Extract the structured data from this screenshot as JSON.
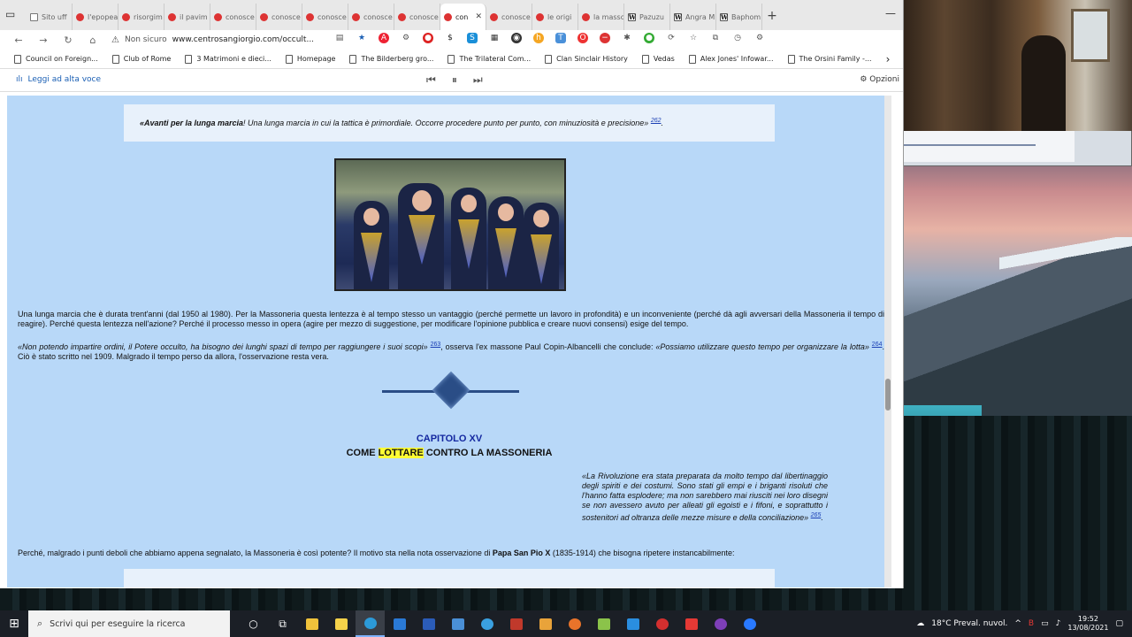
{
  "browser": {
    "tabs": [
      {
        "label": "Sito uff",
        "icon": "document-icon",
        "active": false
      },
      {
        "label": "l'epopea",
        "icon": "site-icon",
        "active": false
      },
      {
        "label": "risorgim",
        "icon": "site-icon",
        "active": false
      },
      {
        "label": "il pavim",
        "icon": "site-icon",
        "active": false
      },
      {
        "label": "conosce",
        "icon": "site-icon",
        "active": false
      },
      {
        "label": "conosce",
        "icon": "site-icon",
        "active": false
      },
      {
        "label": "conosce",
        "icon": "site-icon",
        "active": false
      },
      {
        "label": "conosce",
        "icon": "site-icon",
        "active": false
      },
      {
        "label": "conosce",
        "icon": "site-icon",
        "active": false
      },
      {
        "label": "con",
        "icon": "site-icon",
        "active": true
      },
      {
        "label": "conosce",
        "icon": "site-icon",
        "active": false
      },
      {
        "label": "le origi",
        "icon": "site-icon",
        "active": false
      },
      {
        "label": "la masso",
        "icon": "site-icon",
        "active": false
      },
      {
        "label": "Pazuzu",
        "icon": "wikipedia-icon",
        "active": false
      },
      {
        "label": "Angra M",
        "icon": "wikipedia-icon",
        "active": false
      },
      {
        "label": "Baphom",
        "icon": "wikipedia-icon",
        "active": false
      }
    ],
    "security_label": "Non sicuro",
    "url": "www.centrosangiorgio.com/occult...",
    "bookmarks": [
      "Council on Foreign...",
      "Club of Rome",
      "3 Matrimoni e dieci...",
      "Homepage",
      "The Bilderberg gro...",
      "The Trilateral Com...",
      "Clan Sinclair History",
      "Vedas",
      "Alex Jones' Infowar...",
      "The Orsini Family -..."
    ],
    "reader": {
      "read_aloud": "Leggi ad alta voce",
      "options": "Opzioni"
    }
  },
  "article": {
    "quote1_bold": "«Avanti per la lunga marcia",
    "quote1_rest": "! Una lunga marcia in cui la tattica è primordiale. Occorre procedere punto per punto, con minuziosità e precisione»",
    "ref262": "262",
    "para1": "Una lunga marcia che è durata trent'anni (dal 1950 al 1980). Per la Massoneria questa lentezza è al tempo stesso un vantaggio (perché permette un lavoro in profondità) e un inconveniente (perché dà agli avversari della Massoneria il tempo di reagire). Perché questa lentezza nell'azione? Perché il processo messo in opera (agire per mezzo di suggestione, per modificare l'opinione pubblica e creare nuovi consensi) esige del tempo.",
    "para2_quote": "«Non potendo impartire ordini, il Potere occulto, ha bisogno dei lunghi spazi di tempo per raggiungere i suoi scopi»",
    "ref263": "263",
    "para2_mid": ", osserva l'ex massone Paul Copin-Albancelli che conclude: ",
    "para2_quote2": "«Possiamo utilizzare questo tempo per organizzare la lotta»",
    "ref264": "264",
    "para2_end": ". Ciò è stato scritto nel 1909. Malgrado il tempo perso da allora, l'osservazione resta vera.",
    "chapter_number": "CAPITOLO XV",
    "chapter_title_pre": "COME ",
    "chapter_title_highlight": "LOTTARE",
    "chapter_title_post": " CONTRO LA MASSONERIA",
    "quote2": "«La Rivoluzione era stata preparata da molto tempo dal libertinaggio degli spiriti e dei costumi. Sono stati gli empi e i briganti risoluti che l'hanno fatta esplodere; ma non sarebbero mai riusciti nei loro disegni se non avessero avuto per alleati gli egoisti e i fifoni, e soprattutto i sostenitori ad oltranza delle mezze misure e della conciliazione»",
    "ref265": "265",
    "para3_pre": "Perché, malgrado i punti deboli che abbiamo appena segnalato, la Massoneria è così potente? Il motivo sta nella nota osservazione di ",
    "para3_bold": "Papa San Pio X",
    "para3_post": " (1835-1914) che bisogna ripetere instancabilmente:"
  },
  "taskbar": {
    "search_placeholder": "Scrivi qui per eseguire la ricerca",
    "weather": "18°C  Preval. nuvol.",
    "time": "19:52",
    "date": "13/08/2021"
  }
}
